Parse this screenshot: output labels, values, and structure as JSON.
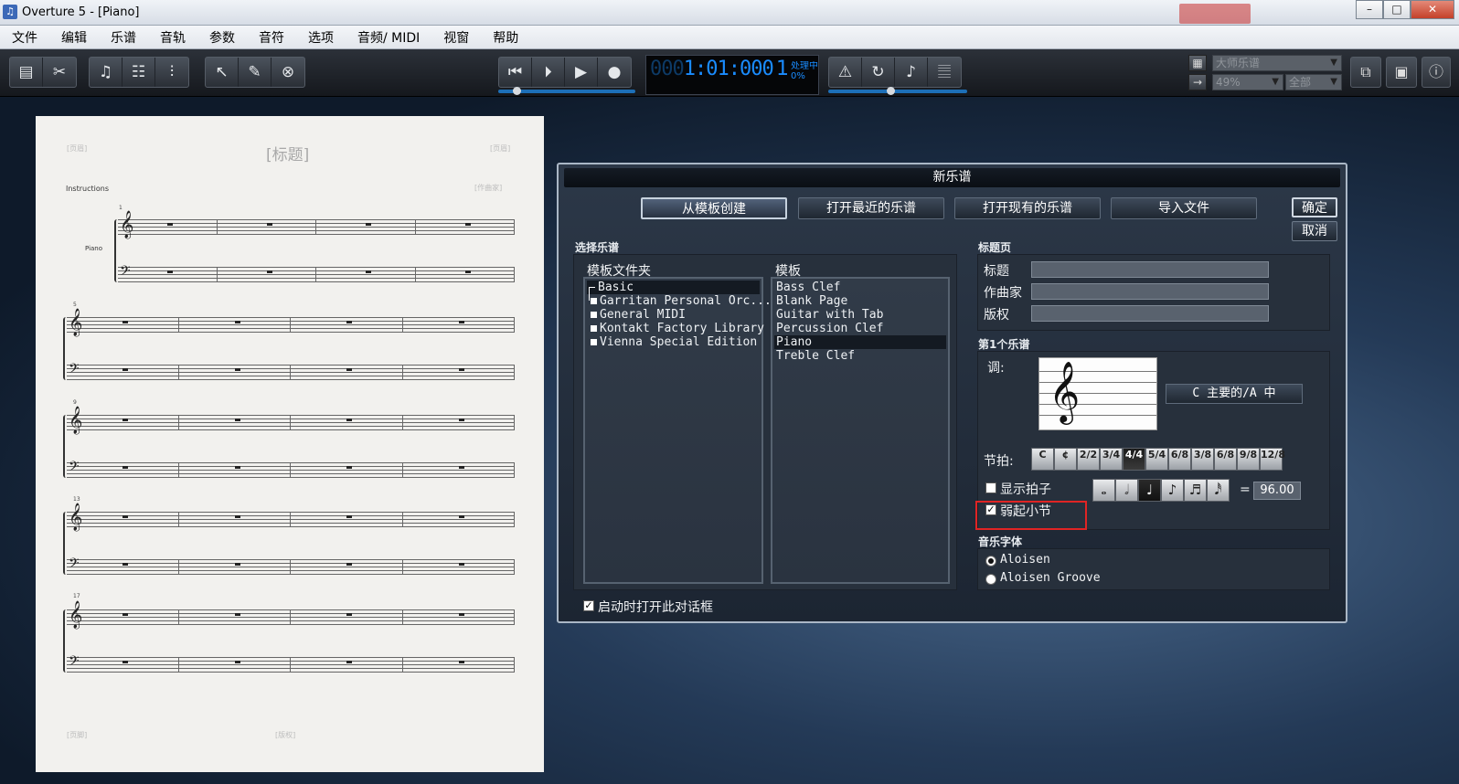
{
  "window": {
    "title": "Overture 5 - [Piano]",
    "min": "–",
    "max": "□",
    "close": "✕",
    "app_icon": "♫"
  },
  "menu": [
    "文件",
    "编辑",
    "乐谱",
    "音轨",
    "参数",
    "音符",
    "选项",
    "音频/ MIDI",
    "视窗",
    "帮助"
  ],
  "toolbar": {
    "counter_dim": "000",
    "counter_time": "1:01:000",
    "counter_beat": "1",
    "processing": "处理中",
    "processing_pct": "0%",
    "view_select": "大师乐谱",
    "zoom_select": "49%",
    "range_select": "全部"
  },
  "score": {
    "title": "[标题]",
    "header_left": "[页眉]",
    "header_right": "[页眉]",
    "composer": "[作曲家]",
    "instructions": "Instructions",
    "instrument": "Piano",
    "footer_left": "[页脚]",
    "footer_center": "[版权]",
    "bar_numbers": [
      "1",
      "5",
      "9",
      "13",
      "17"
    ]
  },
  "dialog": {
    "title": "新乐谱",
    "tabs": [
      "从模板创建",
      "打开最近的乐谱",
      "打开现有的乐谱",
      "导入文件"
    ],
    "ok": "确定",
    "cancel": "取消",
    "choose_score": "选择乐谱",
    "folder_header": "模板文件夹",
    "template_header": "模板",
    "folders": [
      "Basic",
      "Garritan Personal Orc...",
      "General MIDI",
      "Kontakt Factory Library",
      "Vienna Special Edition"
    ],
    "templates": [
      "Bass Clef",
      "Blank Page",
      "Guitar with Tab",
      "Percussion Clef",
      "Piano",
      "Treble Clef"
    ],
    "title_page": "标题页",
    "title_label": "标题",
    "composer_label": "作曲家",
    "copyright_label": "版权",
    "first_score": "第1个乐谱",
    "key_label": "调:",
    "key_value": "C 主要的/A 中",
    "meter_label": "节拍:",
    "meters": [
      "C",
      "¢",
      "2/2",
      "3/4",
      "4/4",
      "5/4",
      "6/8",
      "3/8",
      "6/8",
      "9/8",
      "12/8"
    ],
    "show_beat": "显示拍子",
    "pickup": "弱起小节",
    "equals": "=",
    "tempo": "96.00",
    "font_section": "音乐字体",
    "fonts": [
      "Aloisen",
      "Aloisen Groove"
    ],
    "startup": "启动时打开此对话框"
  }
}
